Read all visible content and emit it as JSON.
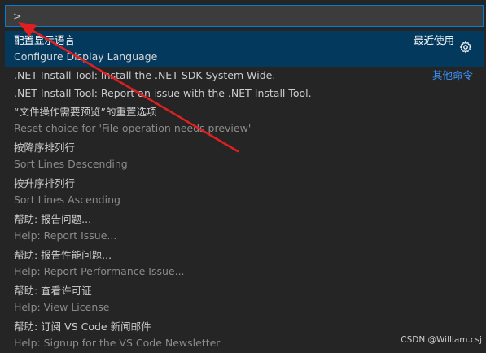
{
  "input": {
    "value": ">"
  },
  "selected": {
    "title": "配置显示语言",
    "detail": "Configure Display Language",
    "recent_label": "最近使用",
    "gear_icon": "gear-icon"
  },
  "singles": [
    {
      "title": ".NET Install Tool: Install the .NET SDK System-Wide.",
      "right": "其他命令"
    },
    {
      "title": ".NET Install Tool: Report an issue with the .NET Install Tool."
    }
  ],
  "items": [
    {
      "title": "“文件操作需要预览”的重置选项",
      "detail": "Reset choice for 'File operation needs preview'"
    },
    {
      "title": "按降序排列行",
      "detail": "Sort Lines Descending"
    },
    {
      "title": "按升序排列行",
      "detail": "Sort Lines Ascending"
    },
    {
      "title": "帮助: 报告问题...",
      "detail": "Help: Report Issue..."
    },
    {
      "title": "帮助: 报告性能问题...",
      "detail": "Help: Report Performance Issue..."
    },
    {
      "title": "帮助: 查看许可证",
      "detail": "Help: View License"
    },
    {
      "title": "帮助: 订阅 VS Code 新闻邮件",
      "detail": "Help: Signup for the VS Code Newsletter"
    }
  ],
  "watermark": "CSDN @William.csj",
  "colors": {
    "accent": "#007fd4",
    "selection": "#04395e",
    "link": "#3794ff",
    "annotation_arrow": "#e02020"
  }
}
